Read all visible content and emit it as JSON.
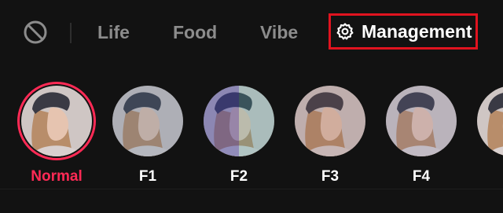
{
  "tabs": {
    "items": [
      {
        "label": "Life"
      },
      {
        "label": "Food"
      },
      {
        "label": "Vibe"
      }
    ],
    "management": {
      "label": "Management",
      "icon": "gear-icon",
      "highlight_color": "#e0131f"
    },
    "none_icon": "no-filter-icon"
  },
  "filters": {
    "selected_color": "#ff2a55",
    "items": [
      {
        "label": "Normal",
        "selected": true
      },
      {
        "label": "F1",
        "selected": false
      },
      {
        "label": "F2",
        "selected": false
      },
      {
        "label": "F3",
        "selected": false
      },
      {
        "label": "F4",
        "selected": false
      }
    ]
  }
}
